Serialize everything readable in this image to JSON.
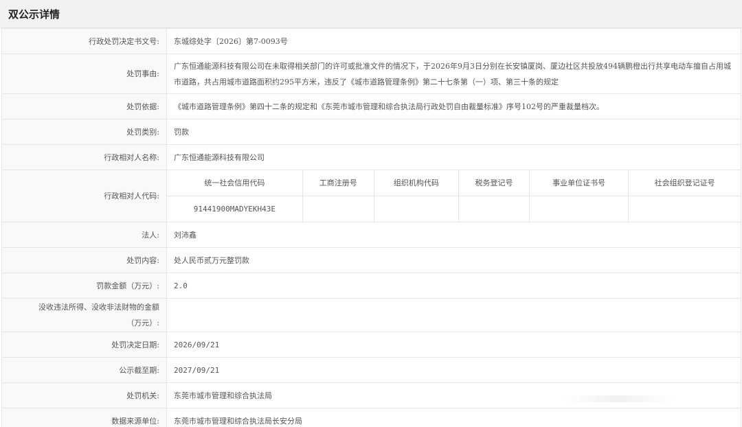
{
  "page_title": "双公示详情",
  "rows": [
    {
      "label": "行政处罚决定书文号:",
      "value": "东城综处字〔2026〕第7-0093号"
    },
    {
      "label": "处罚事由:",
      "value": "广东恒通能源科技有限公司在未取得相关部门的许可或批准文件的情况下，于2026年9月3日分别在长安镇厦岗、厦边社区共投放494辆鹏橙出行共享电动车擅自占用城市道路，共占用城市道路面积约295平方米，违反了《城市道路管理条例》第二十七条第（一）项、第三十条的规定"
    },
    {
      "label": "处罚依据:",
      "value": "《城市道路管理条例》第四十二条的规定和《东莞市城市管理和综合执法局行政处罚自由裁量标准》序号102号的严重裁量档次。"
    },
    {
      "label": "处罚类别:",
      "value": "罚款"
    },
    {
      "label": "行政相对人名称:",
      "value": "广东恒通能源科技有限公司"
    }
  ],
  "codes": {
    "label": "行政相对人代码:",
    "headers": [
      "统一社会信用代码",
      "工商注册号",
      "组织机构代码",
      "税务登记号",
      "事业单位证书号",
      "社会组织登记证号"
    ],
    "values": [
      "91441900MADYEKH43E",
      "",
      "",
      "",
      "",
      ""
    ]
  },
  "rows2": [
    {
      "label": "法人:",
      "value": "刘沛鑫"
    },
    {
      "label": "处罚内容:",
      "value": "处人民币贰万元整罚款"
    },
    {
      "label": "罚款金额（万元）:",
      "value": "2.0"
    },
    {
      "label": "没收违法所得、没收非法财物的金额（万元）:",
      "value": ""
    },
    {
      "label": "处罚决定日期:",
      "value": "2026/09/21"
    },
    {
      "label": "公示截至期:",
      "value": "2027/09/21"
    },
    {
      "label": "处罚机关:",
      "value": "东莞市城市管理和综合执法局"
    },
    {
      "label": "数据来源单位:",
      "value": "东莞市城市管理和综合执法局长安分局"
    }
  ]
}
